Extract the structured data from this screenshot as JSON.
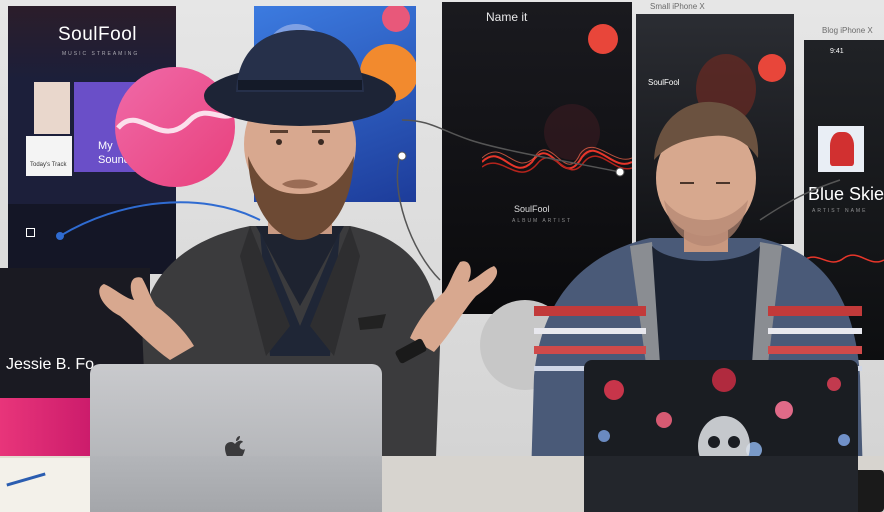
{
  "artboards": {
    "soulfool": {
      "title": "SoulFool",
      "sub": "MUSIC STREAMING",
      "todays_track": "Today's Track",
      "card_text_1": "My",
      "card_text_2": "Sounds",
      "artist": "Jessie B. Fo"
    },
    "name_it": {
      "title": "Name it",
      "track": "SoulFool",
      "track_sub": "ALBUM ARTIST"
    },
    "iphone_a": {
      "label": "Small iPhone X",
      "name": "SoulFool"
    },
    "iphone_b": {
      "label": "Blog iPhone X",
      "time": "9:41",
      "title": "Blue Skies",
      "sub": "ARTIST NAME"
    }
  },
  "colors": {
    "accent_red": "#e8463a",
    "pink": "#e84a8a",
    "orange": "#f28a2e",
    "wave": "#e8362a",
    "blue_board": "#2f6bd1"
  }
}
